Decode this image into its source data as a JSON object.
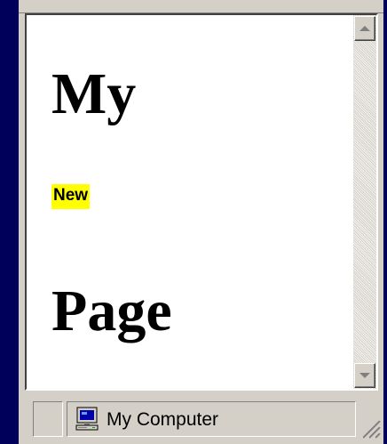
{
  "page": {
    "heading_1": "My",
    "badge": "New",
    "heading_2": "Page"
  },
  "statusbar": {
    "zone_label": "My Computer",
    "zone_icon": "computer-icon"
  },
  "colors": {
    "desktop": "#00005a",
    "chrome": "#d4d0c8",
    "badge_highlight": "#ffff00"
  }
}
